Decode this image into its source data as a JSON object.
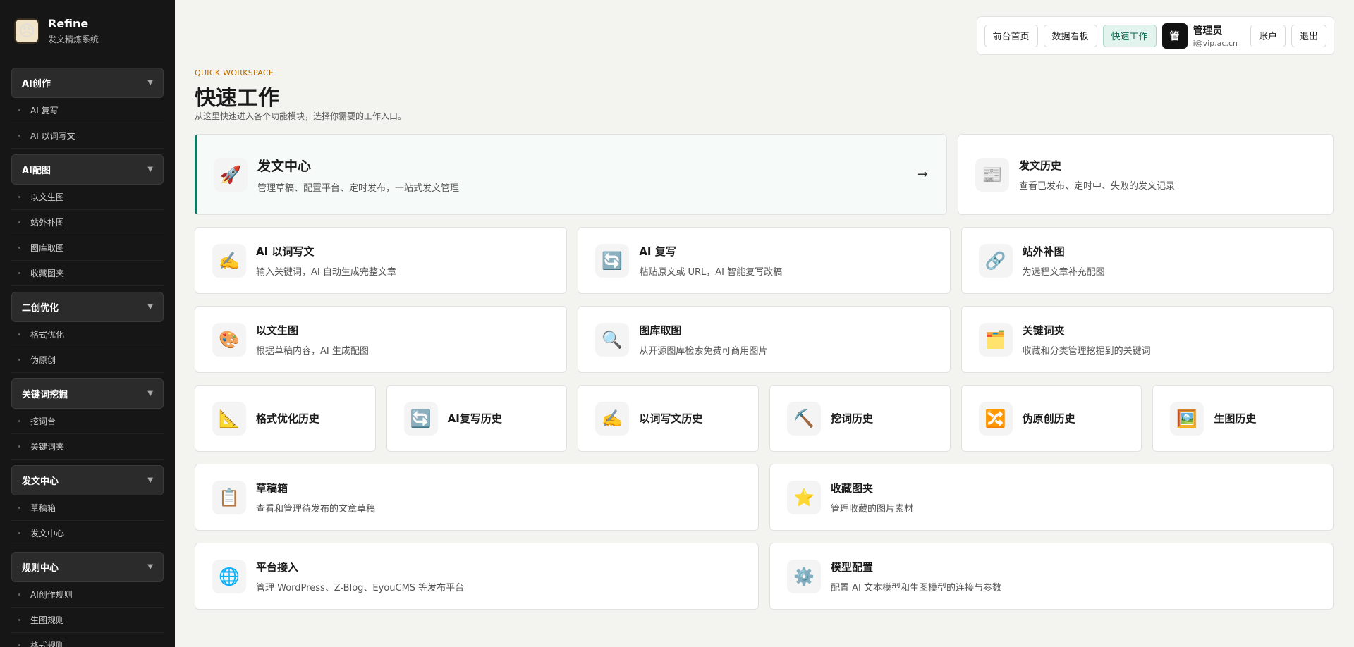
{
  "brand": {
    "name": "Refine",
    "subtitle": "发文精炼系统",
    "logo_icon": "grumpy-face"
  },
  "sidebar": {
    "groups": [
      {
        "label": "AI创作",
        "items": [
          "AI 复写",
          "AI 以词写文"
        ]
      },
      {
        "label": "AI配图",
        "items": [
          "以文生图",
          "站外补图",
          "图库取图",
          "收藏图夹"
        ]
      },
      {
        "label": "二创优化",
        "items": [
          "格式优化",
          "伪原创"
        ]
      },
      {
        "label": "关键词挖掘",
        "items": [
          "挖词台",
          "关键词夹"
        ]
      },
      {
        "label": "发文中心",
        "items": [
          "草稿箱",
          "发文中心"
        ]
      },
      {
        "label": "规则中心",
        "items": [
          "AI创作规则",
          "生图规则",
          "格式规则"
        ]
      }
    ]
  },
  "topbar": {
    "buttons": [
      "前台首页",
      "数据看板",
      "快速工作"
    ],
    "active_button": "快速工作",
    "avatar": "管",
    "user_name": "管理员",
    "user_email": "i@vip.ac.cn",
    "account": "账户",
    "logout": "退出"
  },
  "header": {
    "eyebrow": "QUICK WORKSPACE",
    "title": "快速工作",
    "desc": "从这里快速进入各个功能模块，选择你需要的工作入口。"
  },
  "cards": {
    "hero": {
      "title": "发文中心",
      "desc": "管理草稿、配置平台、定时发布，一站式发文管理",
      "icon": "🚀",
      "arrow": "→"
    },
    "history": {
      "title": "发文历史",
      "desc": "查看已发布、定时中、失败的发文记录",
      "icon": "📰"
    },
    "row2": [
      {
        "title": "AI 以词写文",
        "desc": "输入关键词，AI 自动生成完整文章",
        "icon": "✍️"
      },
      {
        "title": "AI 复写",
        "desc": "粘贴原文或 URL，AI 智能复写改稿",
        "icon": "🔄"
      },
      {
        "title": "站外补图",
        "desc": "为远程文章补充配图",
        "icon": "🔗"
      }
    ],
    "row3": [
      {
        "title": "以文生图",
        "desc": "根据草稿内容，AI 生成配图",
        "icon": "🎨"
      },
      {
        "title": "图库取图",
        "desc": "从开源图库检索免费可商用图片",
        "icon": "🔍"
      },
      {
        "title": "关键词夹",
        "desc": "收藏和分类管理挖掘到的关键词",
        "icon": "🗂️"
      }
    ],
    "row4": [
      {
        "title": "格式优化历史",
        "icon": "📐"
      },
      {
        "title": "AI复写历史",
        "icon": "🔄"
      },
      {
        "title": "以词写文历史",
        "icon": "✍️"
      },
      {
        "title": "挖词历史",
        "icon": "⛏️"
      },
      {
        "title": "伪原创历史",
        "icon": "🔀"
      },
      {
        "title": "生图历史",
        "icon": "🖼️"
      }
    ],
    "row5": [
      {
        "title": "草稿箱",
        "desc": "查看和管理待发布的文章草稿",
        "icon": "📋"
      },
      {
        "title": "收藏图夹",
        "desc": "管理收藏的图片素材",
        "icon": "⭐"
      }
    ],
    "row6": [
      {
        "title": "平台接入",
        "desc": "管理 WordPress、Z-Blog、EyouCMS 等发布平台",
        "icon": "🌐"
      },
      {
        "title": "模型配置",
        "desc": "配置 AI 文本模型和生图模型的连接与参数",
        "icon": "⚙️"
      }
    ]
  },
  "colors": {
    "accent": "#0e7a62",
    "sidebar_bg": "#161616",
    "page_bg": "#f3f3f0"
  }
}
